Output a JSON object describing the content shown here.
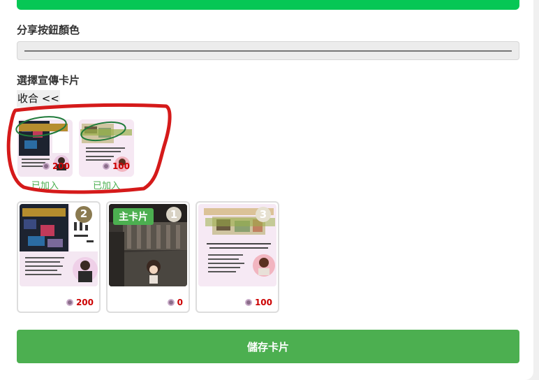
{
  "share_button_color": {
    "label": "分享按鈕顏色"
  },
  "promo_cards": {
    "label": "選擇宣傳卡片",
    "collapse_label": "收合 <<",
    "selected": [
      {
        "added_label": "已加入",
        "views": "200",
        "image": "seminar-poster-1"
      },
      {
        "added_label": "已加入",
        "views": "100",
        "image": "seminar-poster-2"
      }
    ],
    "cards": [
      {
        "views": "200",
        "number": "2",
        "image": "poster-tools",
        "badge": ""
      },
      {
        "views": "0",
        "number": "1",
        "image": "room-avatar",
        "badge": "主卡片"
      },
      {
        "views": "100",
        "number": "3",
        "image": "event-poster",
        "badge": ""
      }
    ]
  },
  "save_button": {
    "label": "儲存卡片"
  },
  "colors": {
    "accent": "#06c755",
    "button": "#4caf50",
    "added": "#4caf50",
    "views": "#cc0000",
    "annotation_red": "#d51a1a"
  }
}
